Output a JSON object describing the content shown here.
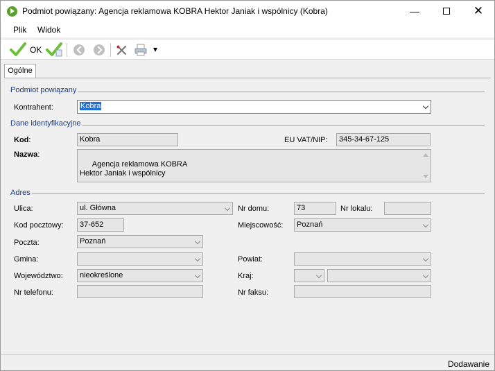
{
  "window": {
    "title": "Podmiot powiązany: Agencja reklamowa KOBRA Hektor Janiak i wspólnicy  (Kobra)",
    "min": "—",
    "close": "✕"
  },
  "menu": {
    "items": [
      "Plik",
      "Widok"
    ]
  },
  "toolbar": {
    "ok_label": "OK",
    "dropdown": "▾"
  },
  "tabs": [
    {
      "label": "Ogólne"
    }
  ],
  "sections": {
    "related": "Podmiot powiązany",
    "ident": "Dane identyfikacyjne",
    "address": "Adres"
  },
  "related": {
    "contractor_label": "Kontrahent:",
    "contractor_value": "Kobra"
  },
  "ident": {
    "code_label": "Kod",
    "code_colon": ":",
    "code_value": "Kobra",
    "vat_label": "EU VAT/NIP:",
    "vat_value": "345-34-67-125",
    "name_label": "Nazwa",
    "name_colon": ":",
    "name_value": "Agencja reklamowa KOBRA\nHektor Janiak i wspólnicy"
  },
  "address": {
    "street_label": "Ulica:",
    "street_value": "ul. Główna",
    "house_label": "Nr domu:",
    "house_value": "73",
    "flat_label": "Nr lokalu:",
    "flat_value": "",
    "postcode_label": "Kod pocztowy:",
    "postcode_value": "37-652",
    "city_label": "Miejscowość:",
    "city_value": "Poznań",
    "post_label": "Poczta:",
    "post_value": "Poznań",
    "commune_label": "Gmina:",
    "commune_value": "",
    "county_label": "Powiat:",
    "county_value": "",
    "province_label": "Województwo:",
    "province_value": "nieokreślone",
    "country_label": "Kraj:",
    "country_code": "",
    "country_value": "",
    "phone_label": "Nr telefonu:",
    "phone_value": "",
    "fax_label": "Nr faksu:",
    "fax_value": ""
  },
  "status": {
    "mode": "Dodawanie"
  },
  "colors": {
    "accent": "#1e6fd6",
    "section_title": "#1a3a8a",
    "ok_green": "#5aa02c"
  }
}
